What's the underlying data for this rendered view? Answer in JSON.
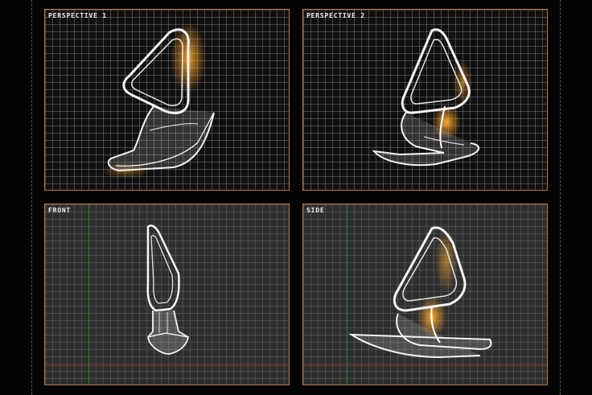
{
  "viewports": {
    "perspective1": {
      "label": "PERSPECTIVE 1"
    },
    "perspective2": {
      "label": "PERSPECTIVE 2"
    },
    "front": {
      "label": "FRONT"
    },
    "side": {
      "label": "SIDE"
    }
  },
  "colors": {
    "background": "#030303",
    "viewport_border": "#b7773f",
    "highlight": "#f0a020",
    "axis_vertical": "#1c8f2a",
    "axis_horizontal": "#8a2a2a"
  }
}
